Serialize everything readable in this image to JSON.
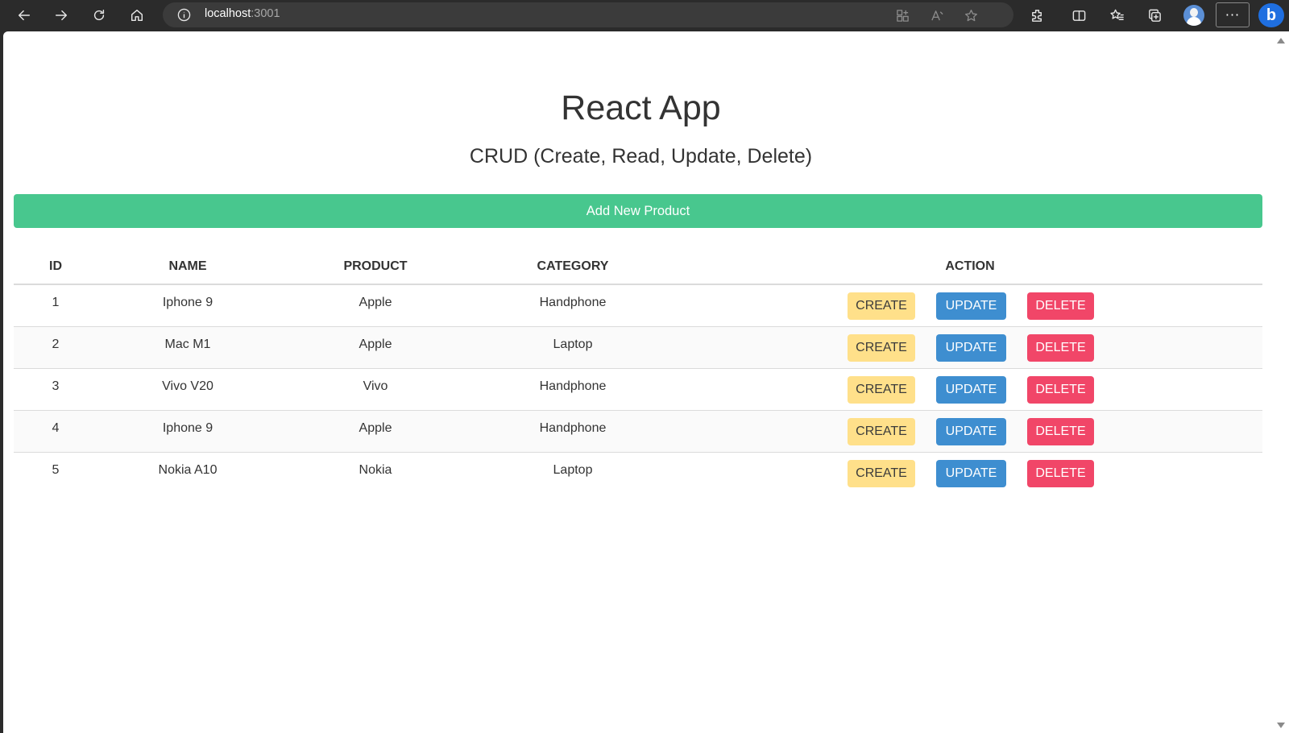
{
  "browser": {
    "url_host": "localhost",
    "url_port": ":3001"
  },
  "page": {
    "title": "React App",
    "subtitle": "CRUD (Create, Read, Update, Delete)",
    "add_button_label": "Add New Product"
  },
  "table": {
    "headers": {
      "id": "ID",
      "name": "NAME",
      "product": "PRODUCT",
      "category": "CATEGORY",
      "action": "ACTION"
    },
    "action_labels": {
      "create": "CREATE",
      "update": "UPDATE",
      "delete": "DELETE"
    },
    "rows": [
      {
        "id": "1",
        "name": "Iphone 9",
        "product": "Apple",
        "category": "Handphone"
      },
      {
        "id": "2",
        "name": "Mac M1",
        "product": "Apple",
        "category": "Laptop"
      },
      {
        "id": "3",
        "name": "Vivo V20",
        "product": "Vivo",
        "category": "Handphone"
      },
      {
        "id": "4",
        "name": "Iphone 9",
        "product": "Apple",
        "category": "Handphone"
      },
      {
        "id": "5",
        "name": "Nokia A10",
        "product": "Nokia",
        "category": "Laptop"
      }
    ]
  },
  "colors": {
    "add_button": "#48c78e",
    "create_button": "#ffe08a",
    "update_button": "#3e8ed0",
    "delete_button": "#f14668"
  }
}
